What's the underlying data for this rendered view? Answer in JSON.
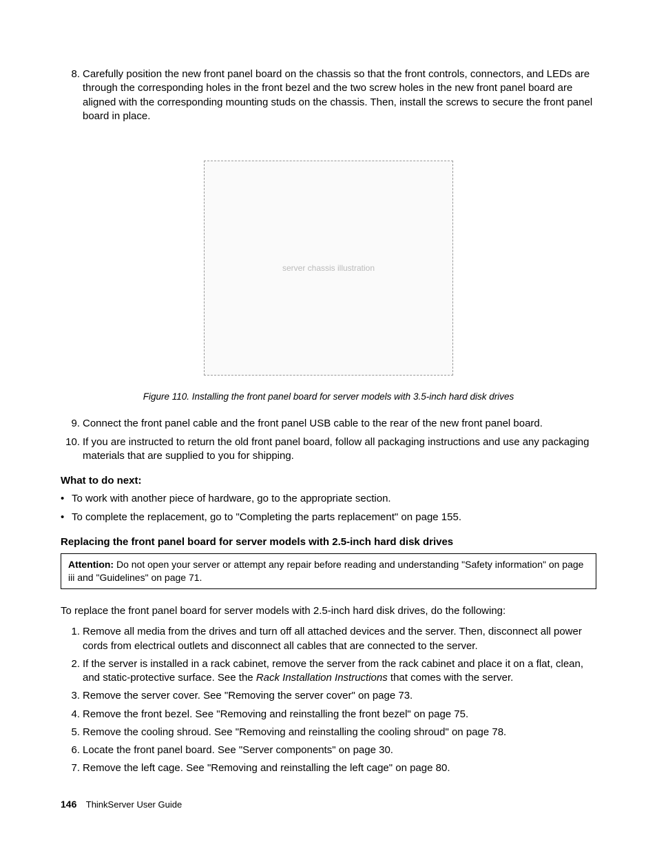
{
  "steps_top": [
    {
      "num": "8.",
      "text": "Carefully position the new front panel board on the chassis so that the front controls, connectors, and LEDs are through the corresponding holes in the front bezel and the two screw holes in the new front panel board are aligned with the corresponding mounting studs on the chassis. Then, install the screws to secure the front panel board in place."
    }
  ],
  "figure": {
    "alt": "server chassis illustration",
    "caption": "Figure 110. Installing the front panel board for server models with 3.5-inch hard disk drives"
  },
  "steps_after_fig": [
    {
      "num": "9.",
      "text": "Connect the front panel cable and the front panel USB cable to the rear of the new front panel board."
    },
    {
      "num": "10.",
      "text": "If you are instructed to return the old front panel board, follow all packaging instructions and use any packaging materials that are supplied to you for shipping."
    }
  ],
  "whatnext_head": "What to do next:",
  "whatnext_items": [
    "To work with another piece of hardware, go to the appropriate section.",
    "To complete the replacement, go to \"Completing the parts replacement\" on page 155."
  ],
  "section2_head": "Replacing the front panel board for server models with 2.5-inch hard disk drives",
  "attention": {
    "label": "Attention:",
    "text": " Do not open your server or attempt any repair before reading and understanding \"Safety information\" on page iii and \"Guidelines\" on page 71."
  },
  "intro": "To replace the front panel board for server models with 2.5-inch hard disk drives, do the following:",
  "steps_bottom": [
    {
      "num": "1.",
      "text": "Remove all media from the drives and turn off all attached devices and the server. Then, disconnect all power cords from electrical outlets and disconnect all cables that are connected to the server."
    },
    {
      "num": "2.",
      "text_pre": "If the server is installed in a rack cabinet, remove the server from the rack cabinet and place it on a flat, clean, and static-protective surface. See the ",
      "italic": "Rack Installation Instructions",
      "text_post": " that comes with the server."
    },
    {
      "num": "3.",
      "text": "Remove the server cover. See \"Removing the server cover\" on page 73."
    },
    {
      "num": "4.",
      "text": "Remove the front bezel. See \"Removing and reinstalling the front bezel\" on page 75."
    },
    {
      "num": "5.",
      "text": "Remove the cooling shroud. See \"Removing and reinstalling the cooling shroud\" on page 78."
    },
    {
      "num": "6.",
      "text": "Locate the front panel board. See \"Server components\" on page 30."
    },
    {
      "num": "7.",
      "text": "Remove the left cage. See \"Removing and reinstalling the left cage\" on page 80."
    }
  ],
  "footer": {
    "pagenum": "146",
    "title": "ThinkServer User Guide"
  }
}
